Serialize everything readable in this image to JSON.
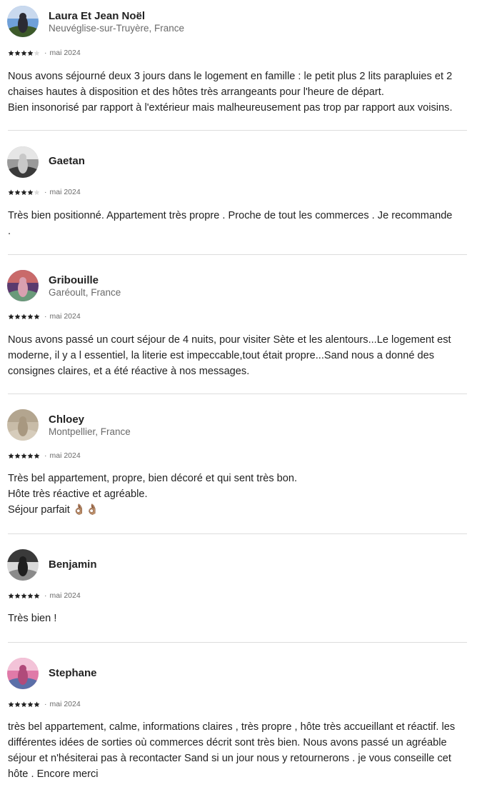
{
  "reviews": [
    {
      "author": "Laura Et Jean Noël",
      "location": "Neuvéglise-sur-Truyère, France",
      "rating": 4,
      "date": "mai 2024",
      "separator": "·",
      "text": "Nous avons séjourné deux 3 jours dans le logement en famille : le petit plus 2 lits parapluies et 2\nchaises hautes à disposition et des hôtes très arrangeants pour l'heure de départ.\nBien insonorisé par rapport à l'extérieur mais malheureusement pas trop par rapport aux voisins.",
      "avatar_colors": [
        "#6fa0d8",
        "#c9d9ee",
        "#3d5a2a",
        "#2b2b33"
      ]
    },
    {
      "author": "Gaetan",
      "location": "",
      "rating": 4,
      "date": "mai 2024",
      "separator": "·",
      "text": "Très bien positionné. Appartement très propre . Proche de tout les commerces . Je recommande\n.",
      "avatar_colors": [
        "#9a9a9a",
        "#e6e6e6",
        "#3a3a3a",
        "#c8c8c8"
      ]
    },
    {
      "author": "Gribouille",
      "location": "Garéoult, France",
      "rating": 5,
      "date": "mai 2024",
      "separator": "·",
      "text": "Nous avons passé un court séjour de 4 nuits, pour visiter Sète et les alentours...Le logement est\nmoderne, il y a l essentiel, la literie est impeccable,tout était propre...Sand nous a donné des\nconsignes claires, et a été réactive à nos messages.",
      "avatar_colors": [
        "#5b3a6e",
        "#c96a6a",
        "#6a9a7a",
        "#d9a0b0"
      ]
    },
    {
      "author": "Chloey",
      "location": "Montpellier, France",
      "rating": 5,
      "date": "mai 2024",
      "separator": "·",
      "text": "Très bel appartement, propre, bien décoré et qui sent très bon.\nHôte très réactive et agréable.\nSéjour parfait 👌🏽👌🏽",
      "avatar_colors": [
        "#c8bca8",
        "#b3a58f",
        "#d6ccbb",
        "#a89880"
      ]
    },
    {
      "author": "Benjamin",
      "location": "",
      "rating": 5,
      "date": "mai 2024",
      "separator": "·",
      "text": "Très bien !",
      "avatar_colors": [
        "#d9d9d9",
        "#3a3a3a",
        "#8a8a8a",
        "#1e1e1e"
      ]
    },
    {
      "author": "Stephane",
      "location": "",
      "rating": 5,
      "date": "mai 2024",
      "separator": "·",
      "text": "très bel appartement, calme, informations claires , très propre , hôte très accueillant et réactif. les\ndifférentes idées de sorties où commerces décrit sont très bien. Nous avons passé un agréable\nséjour et n'hésiterai pas à recontacter Sand si un jour nous y retournerons . je vous conseille cet\nhôte . Encore merci",
      "avatar_colors": [
        "#e07aa8",
        "#f3c3d8",
        "#5b6fa8",
        "#b04a7a"
      ]
    }
  ],
  "colors": {
    "text": "#222222",
    "muted": "#6a6a6a",
    "divider": "#dddddd",
    "star_filled": "#222222",
    "star_empty": "#dddddd"
  }
}
